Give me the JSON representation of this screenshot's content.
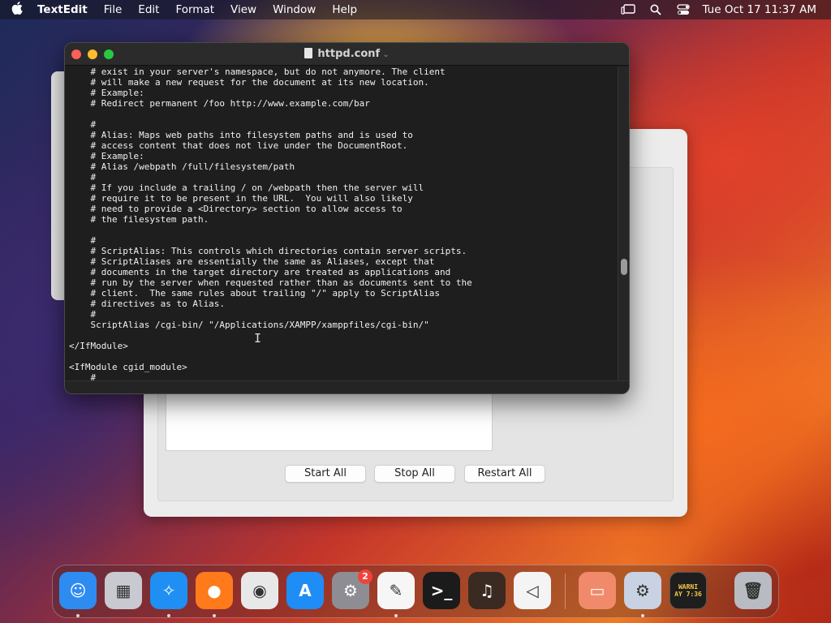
{
  "menubar": {
    "app_name": "TextEdit",
    "items": [
      "File",
      "Edit",
      "Format",
      "View",
      "Window",
      "Help"
    ],
    "clock": "Tue Oct 17  11:37 AM"
  },
  "editor": {
    "title": "httpd.conf",
    "lines": [
      "    # exist in your server's namespace, but do not anymore. The client",
      "    # will make a new request for the document at its new location.",
      "    # Example:",
      "    # Redirect permanent /foo http://www.example.com/bar",
      "",
      "    #",
      "    # Alias: Maps web paths into filesystem paths and is used to",
      "    # access content that does not live under the DocumentRoot.",
      "    # Example:",
      "    # Alias /webpath /full/filesystem/path",
      "    #",
      "    # If you include a trailing / on /webpath then the server will",
      "    # require it to be present in the URL.  You will also likely",
      "    # need to provide a <Directory> section to allow access to",
      "    # the filesystem path.",
      "",
      "    #",
      "    # ScriptAlias: This controls which directories contain server scripts.",
      "    # ScriptAliases are essentially the same as Aliases, except that",
      "    # documents in the target directory are treated as applications and",
      "    # run by the server when requested rather than as documents sent to the",
      "    # client.  The same rules about trailing \"/\" apply to ScriptAlias",
      "    # directives as to Alias.",
      "    #",
      "    ScriptAlias /cgi-bin/ \"/Applications/XAMPP/xamppfiles/cgi-bin/\"",
      "",
      "</IfModule>",
      "",
      "<IfModule cgid_module>",
      "    #"
    ]
  },
  "xampp": {
    "start_all": "Start All",
    "stop_all": "Stop All",
    "restart_all": "Restart All"
  },
  "dock": {
    "items": [
      {
        "name": "finder",
        "glyph": "☺",
        "color": "#2e8bf0"
      },
      {
        "name": "launchpad",
        "glyph": "▦",
        "color": "#c9c9d1"
      },
      {
        "name": "safari",
        "glyph": "✧",
        "color": "#1f8ff3"
      },
      {
        "name": "firefox",
        "glyph": "●",
        "color": "#ff7a1a"
      },
      {
        "name": "chrome",
        "glyph": "◉",
        "color": "#e8e8e8"
      },
      {
        "name": "app-store",
        "glyph": "A",
        "color": "#1e8df5"
      },
      {
        "name": "system-settings",
        "glyph": "⚙",
        "color": "#8d8d93"
      },
      {
        "name": "textedit",
        "glyph": "✎",
        "color": "#f6f6f6"
      },
      {
        "name": "terminal",
        "glyph": ">_",
        "color": "#1b1b1b"
      },
      {
        "name": "garageband",
        "glyph": "♫",
        "color": "#3a2a22"
      },
      {
        "name": "vscode",
        "glyph": "◁",
        "color": "#f4f4f4"
      },
      {
        "name": "xampp",
        "glyph": "▭",
        "color": "#f08a6a"
      },
      {
        "name": "xampp-manager",
        "glyph": "⚙",
        "color": "#c8d2e2"
      },
      {
        "name": "console",
        "glyph": "",
        "color": "#1e1e1e"
      },
      {
        "name": "trash",
        "glyph": "🗑",
        "color": "#b8bcc2"
      }
    ],
    "badge_count": "2",
    "console_text_1": "WARNI",
    "console_text_2": "AY 7:36"
  }
}
